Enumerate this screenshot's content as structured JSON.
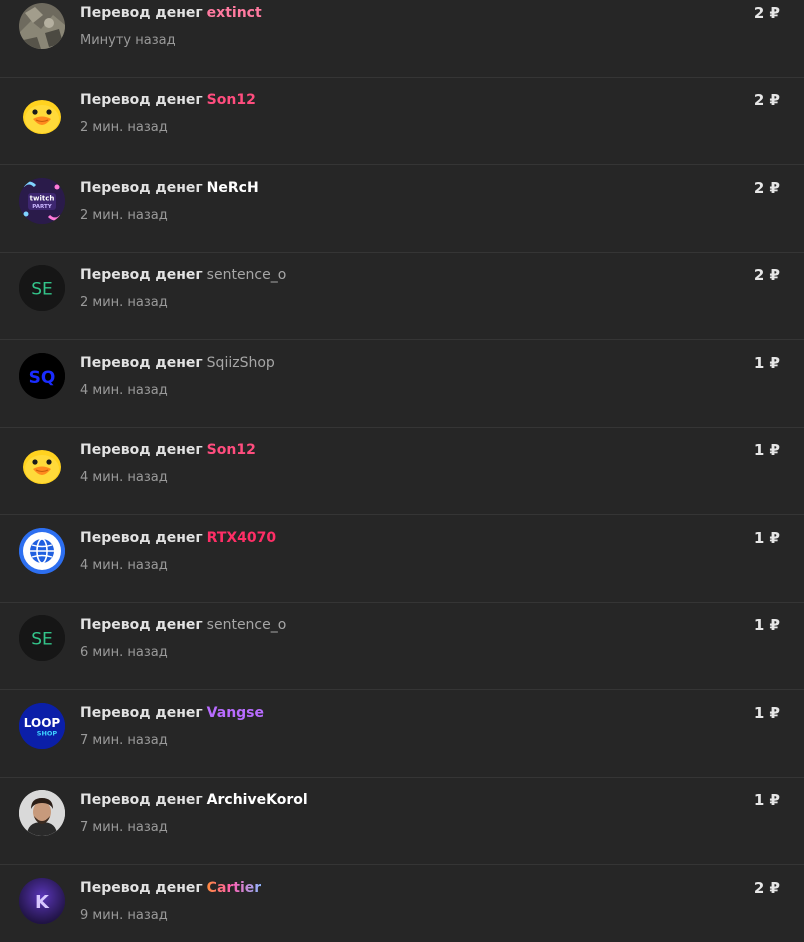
{
  "currency_symbol": "₽",
  "colors": {
    "background": "#262626",
    "divider": "#353535",
    "title_text": "#e6e6e6",
    "time_text": "#9a9a9a"
  },
  "items": [
    {
      "label": "Перевод денег",
      "user": "extinct",
      "user_style": "pinkpale",
      "time": "Минуту назад",
      "amount": "2 ₽",
      "avatar": "photo-avatar-icon"
    },
    {
      "label": "Перевод денег",
      "user": "Son12",
      "user_style": "pink",
      "time": "2 мин. назад",
      "amount": "2 ₽",
      "avatar": "duck-avatar-icon"
    },
    {
      "label": "Перевод денег",
      "user": "NeRcH",
      "user_style": "white",
      "time": "2 мин. назад",
      "amount": "2 ₽",
      "avatar": "twitch-party-avatar-icon"
    },
    {
      "label": "Перевод денег",
      "user": "sentence_o",
      "user_style": "gray",
      "time": "2 мин. назад",
      "amount": "2 ₽",
      "avatar": "se-avatar-icon"
    },
    {
      "label": "Перевод денег",
      "user": "SqiizShop",
      "user_style": "gray",
      "time": "4 мин. назад",
      "amount": "1 ₽",
      "avatar": "sq-avatar-icon"
    },
    {
      "label": "Перевод денег",
      "user": "Son12",
      "user_style": "pink",
      "time": "4 мин. назад",
      "amount": "1 ₽",
      "avatar": "duck-avatar-icon"
    },
    {
      "label": "Перевод денег",
      "user": "RTX4070",
      "user_style": "red",
      "time": "4 мин. назад",
      "amount": "1 ₽",
      "avatar": "globe-avatar-icon"
    },
    {
      "label": "Перевод денег",
      "user": "sentence_o",
      "user_style": "gray",
      "time": "6 мин. назад",
      "amount": "1 ₽",
      "avatar": "se-avatar-icon"
    },
    {
      "label": "Перевод денег",
      "user": "Vangse",
      "user_style": "purple",
      "time": "7 мин. назад",
      "amount": "1 ₽",
      "avatar": "loop-shop-avatar-icon"
    },
    {
      "label": "Перевод денег",
      "user": "ArchiveKorol",
      "user_style": "white",
      "time": "7 мин. назад",
      "amount": "1 ₽",
      "avatar": "person-avatar-icon"
    },
    {
      "label": "Перевод денег",
      "user": "Cartier",
      "user_style": "gradient",
      "time": "9 мин. назад",
      "amount": "2 ₽",
      "avatar": "k-avatar-icon"
    }
  ],
  "avatar_text": {
    "twitch": "twitch",
    "party": "PARTY",
    "se": "SE",
    "sq": "SQ",
    "loop": "LOOP",
    "shop": "SHOP",
    "k": "K"
  }
}
